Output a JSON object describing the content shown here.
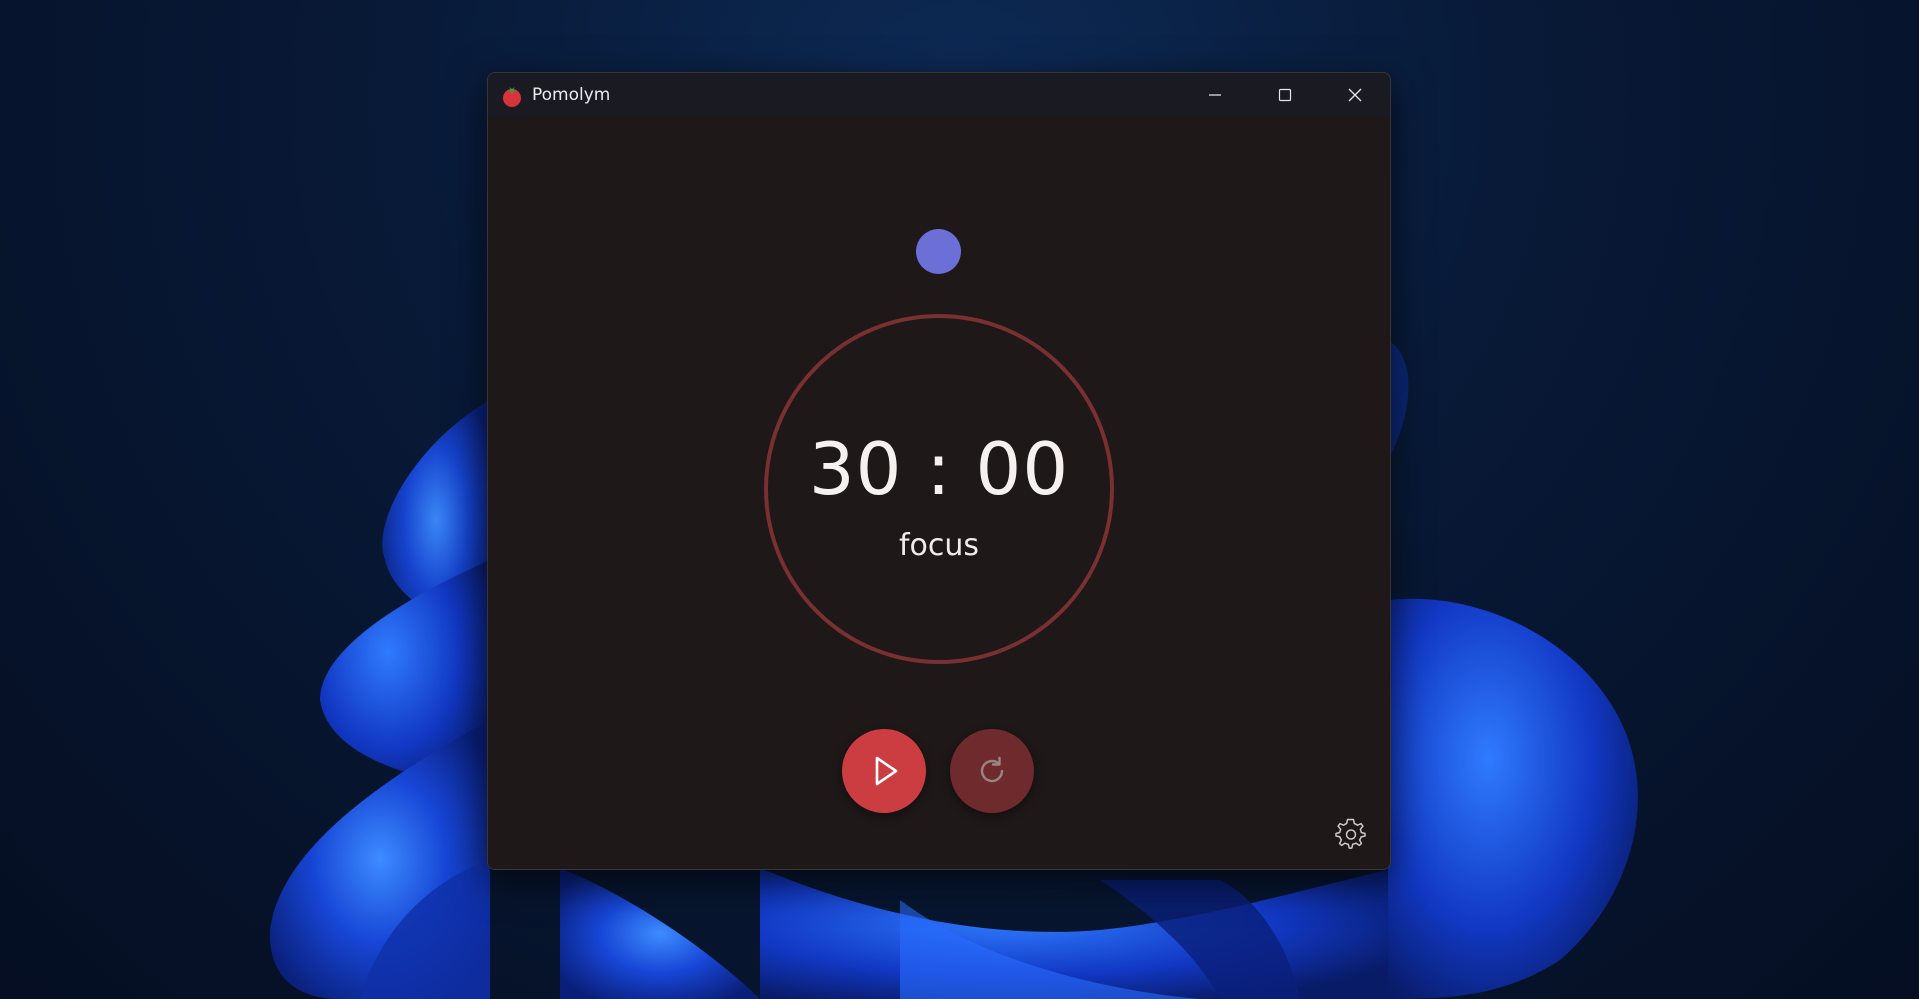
{
  "window": {
    "title": "Pomolym"
  },
  "timer": {
    "display": "30 : 00",
    "mode": "focus"
  },
  "controls": {
    "play_icon": "play-icon",
    "reset_icon": "reset-icon",
    "settings_icon": "gear-icon"
  },
  "colors": {
    "accent_red": "#cc3d42",
    "reset_button": "#6e2a2c",
    "ring": "#7a2f31",
    "session_dot": "#6b6fd6",
    "window_bg": "#1e1818",
    "titlebar_bg": "#1a1b22"
  }
}
